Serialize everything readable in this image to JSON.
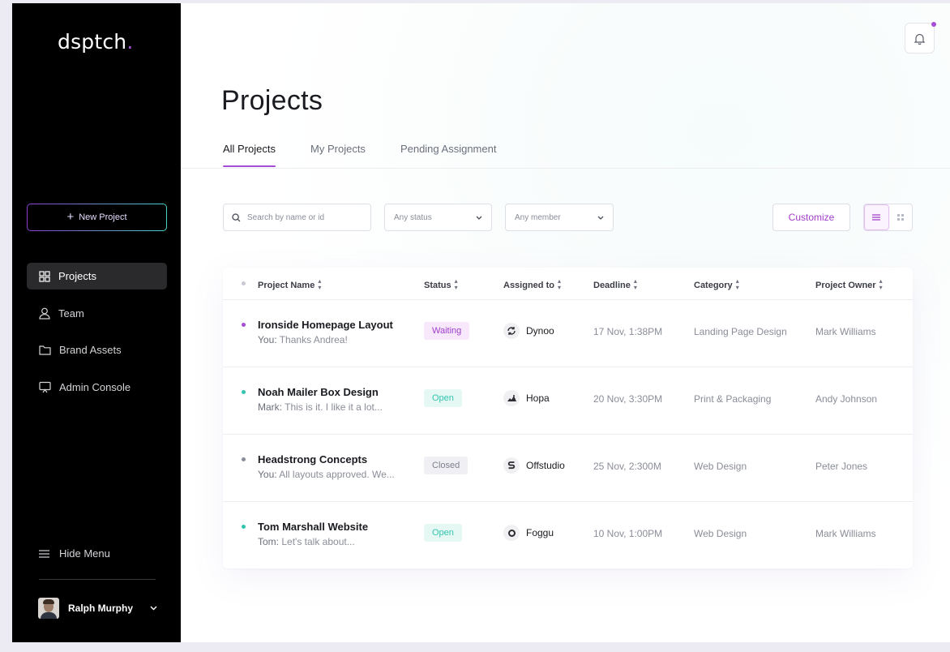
{
  "brand": {
    "logo_text": "dsptch",
    "logo_dot": "."
  },
  "sidebar": {
    "new_project_label": "New Project",
    "items": [
      {
        "label": "Projects",
        "icon": "grid-icon",
        "active": true
      },
      {
        "label": "Team",
        "icon": "user-icon",
        "active": false
      },
      {
        "label": "Brand Assets",
        "icon": "folder-icon",
        "active": false
      },
      {
        "label": "Admin Console",
        "icon": "monitor-icon",
        "active": false
      }
    ],
    "hide_menu_label": "Hide Menu",
    "user_name": "Ralph Murphy"
  },
  "header": {
    "title": "Projects",
    "notification_badge": true
  },
  "tabs": [
    {
      "label": "All Projects",
      "active": true
    },
    {
      "label": "My Projects",
      "active": false
    },
    {
      "label": "Pending Assignment",
      "active": false
    }
  ],
  "filters": {
    "search_placeholder": "Search by name or id",
    "status_value": "Any status",
    "member_value": "Any member",
    "customize_label": "Customize"
  },
  "table": {
    "columns": [
      "Project Name",
      "Status",
      "Assigned to",
      "Deadline",
      "Category",
      "Project Owner"
    ],
    "rows": [
      {
        "name": "Ironside Homepage Layout",
        "msg_author": "You:",
        "msg_text": "Thanks Andrea!",
        "status": "Waiting",
        "assignee": "Dynoo",
        "deadline": "17 Nov, 1:38PM",
        "category": "Landing Page Design",
        "owner": "Mark Williams",
        "dot_color": "#a64dd6"
      },
      {
        "name": "Noah Mailer Box Design",
        "msg_author": "Mark:",
        "msg_text": "This is it. I like it a lot...",
        "status": "Open",
        "assignee": "Hopa",
        "deadline": "20 Nov, 3:30PM",
        "category": "Print & Packaging",
        "owner": "Andy Johnson",
        "dot_color": "#33c4ae"
      },
      {
        "name": "Headstrong Concepts",
        "msg_author": "You:",
        "msg_text": "All layouts approved. We...",
        "status": "Closed",
        "assignee": "Offstudio",
        "deadline": "25 Nov, 2:300M",
        "category": "Web Design",
        "owner": "Peter Jones",
        "dot_color": "#8a8d98"
      },
      {
        "name": "Tom Marshall Website",
        "msg_author": "Tom:",
        "msg_text": "Let's talk about...",
        "status": "Open",
        "assignee": "Foggu",
        "deadline": "10 Nov, 1:00PM",
        "category": "Web Design",
        "owner": "Mark Williams",
        "dot_color": "#33c4ae"
      }
    ]
  },
  "colors": {
    "accent": "#a64dd6",
    "teal": "#33c4ae",
    "sidebar_bg": "#000000"
  }
}
